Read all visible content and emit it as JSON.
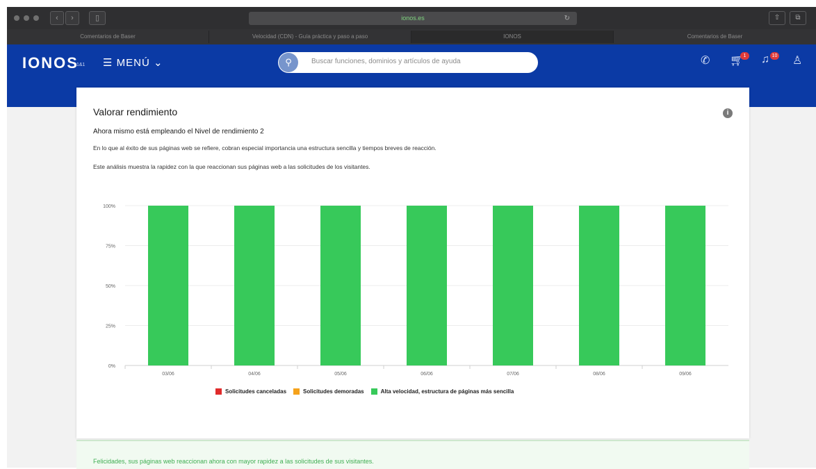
{
  "browser": {
    "url": "ionos.es",
    "tabs": [
      {
        "label": "Comentarios de Baser"
      },
      {
        "label": "Velocidad (CDN) - Guía práctica y paso a paso"
      },
      {
        "label": "IONOS",
        "active": true
      },
      {
        "label": "Comentarios de Baser"
      }
    ]
  },
  "header": {
    "logo": "IONOS",
    "logo_sub": "1&1",
    "menu_label": "MENÚ",
    "search_placeholder": "Buscar funciones, dominios y artículos de ayuda",
    "cart_badge": "1",
    "notifications_badge": "10"
  },
  "card": {
    "title": "Valorar rendimiento",
    "level_text": "Ahora mismo está empleando el Nivel de rendimiento 2",
    "paragraph1": "En lo que al éxito de sus páginas web se refiere, cobran especial importancia una estructura sencilla y tiempos breves de reacción.",
    "paragraph2": "Este análisis muestra la rapidez con la que reaccionan sus páginas web a las solicitudes de los visitantes."
  },
  "chart_data": {
    "type": "bar",
    "stacked": true,
    "categories": [
      "03/06",
      "04/06",
      "05/06",
      "06/06",
      "07/06",
      "08/06",
      "09/06"
    ],
    "series": [
      {
        "name": "Solicitudes canceladas",
        "color": "#e02b2b",
        "values": [
          0,
          0,
          0,
          0,
          0,
          0,
          0
        ]
      },
      {
        "name": "Solicitudes demoradas",
        "color": "#f5a21b",
        "values": [
          0,
          0,
          0,
          0,
          0,
          0,
          0
        ]
      },
      {
        "name": "Alta velocidad, estructura de páginas más sencilla",
        "color": "#37c95a",
        "values": [
          100,
          100,
          100,
          100,
          100,
          100,
          100
        ]
      }
    ],
    "yticks": [
      "0%",
      "25%",
      "50%",
      "75%",
      "100%"
    ],
    "ylim": [
      0,
      100
    ],
    "grid": true,
    "legend_position": "bottom"
  },
  "success_message": "Felicidades, sus páginas web reaccionan ahora con mayor rapidez a las solicitudes de sus visitantes."
}
